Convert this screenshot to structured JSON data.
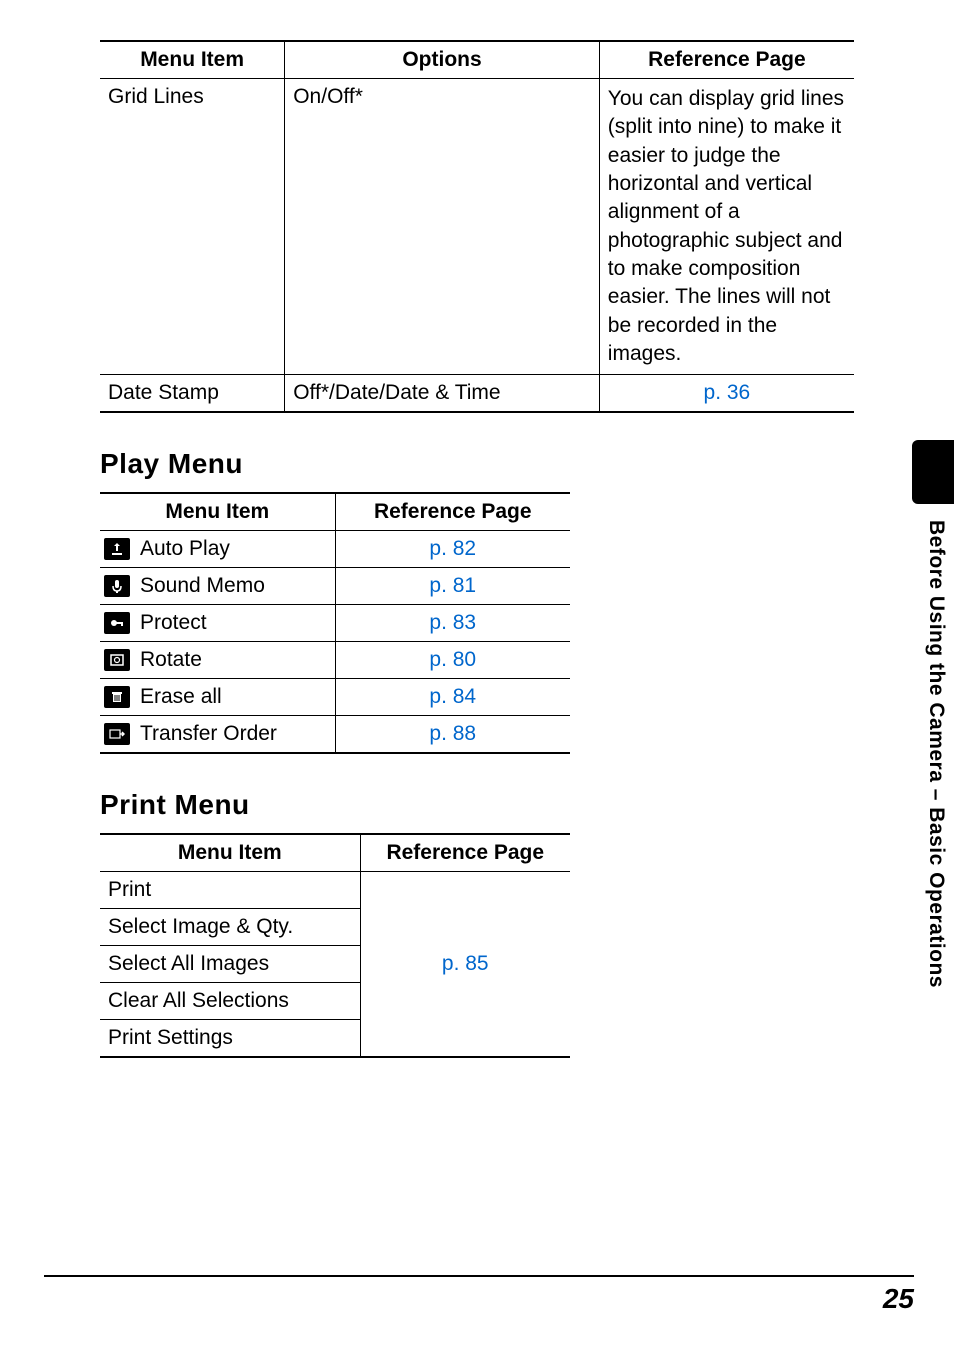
{
  "table1": {
    "headers": [
      "Menu Item",
      "Options",
      "Reference Page"
    ],
    "row1": {
      "menu": "Grid Lines",
      "options": "On/Off*",
      "ref": "You can display grid lines (split into nine) to make it easier to judge the horizontal and vertical alignment of a photographic subject and to make composition easier. The lines will not be recorded in the images."
    },
    "row2": {
      "menu": "Date Stamp",
      "options": "Off*/Date/Date & Time",
      "ref": "p. 36"
    }
  },
  "sections": {
    "play": "Play Menu",
    "print": "Print Menu"
  },
  "play": {
    "headers": [
      "Menu Item",
      "Reference Page"
    ],
    "rows": [
      {
        "label": "Auto Play",
        "ref": "p. 82"
      },
      {
        "label": "Sound Memo",
        "ref": "p. 81"
      },
      {
        "label": "Protect",
        "ref": "p. 83"
      },
      {
        "label": "Rotate",
        "ref": "p. 80"
      },
      {
        "label": "Erase all",
        "ref": "p. 84"
      },
      {
        "label": "Transfer Order",
        "ref": "p. 88"
      }
    ]
  },
  "print": {
    "headers": [
      "Menu Item",
      "Reference Page"
    ],
    "rows": [
      "Print",
      "Select Image & Qty.",
      "Select All Images",
      "Clear All Selections",
      "Print Settings"
    ],
    "ref": "p. 85"
  },
  "side": "Before Using the Camera – Basic Operations",
  "page": "25"
}
